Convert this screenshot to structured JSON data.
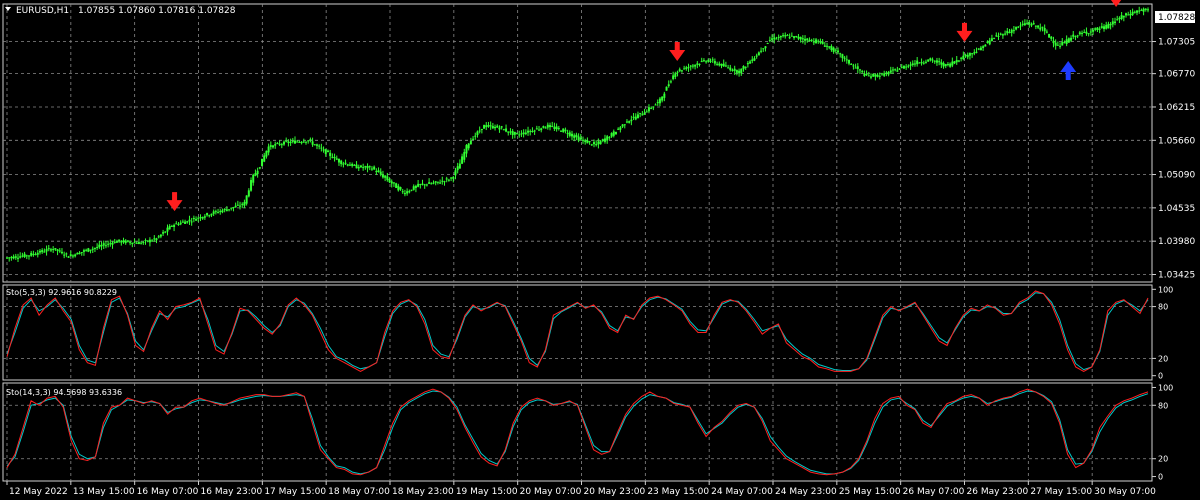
{
  "colors": {
    "background": "#000000",
    "grid": "#8a8a8a",
    "candle": "#32ff32",
    "sell_arrow": "#ff1e1e",
    "buy_arrow": "#1e3cff",
    "stoch_main": "#ff2020",
    "stoch_signal": "#00c8c8",
    "price_tag_bg": "#ffffff",
    "price_tag_text": "#000000"
  },
  "header": {
    "dropdown_icon": "triangle-down-icon",
    "symbol_info": "EURUSD,H1",
    "ohlc": "1.07855 1.07860 1.07816 1.07828"
  },
  "price_tag": "1.07828",
  "chart_data": [
    {
      "type": "candlestick",
      "name": "EURUSD,H1",
      "ylim": [
        1.033,
        1.0793
      ],
      "y_ticks": [
        "1.07828",
        "1.07305",
        "1.06770",
        "1.06215",
        "1.05660",
        "1.05090",
        "1.04535",
        "1.03980",
        "1.03425"
      ],
      "y_tick_values": [
        1.07828,
        1.07305,
        1.0677,
        1.06215,
        1.0566,
        1.0509,
        1.04535,
        1.0398,
        1.03425
      ],
      "x_tick_labels": [
        "12 May 2022",
        "13 May 15:00",
        "16 May 07:00",
        "16 May 23:00",
        "17 May 15:00",
        "18 May 07:00",
        "18 May 23:00",
        "19 May 15:00",
        "20 May 07:00",
        "20 May 23:00",
        "23 May 15:00",
        "24 May 07:00",
        "24 May 23:00",
        "25 May 15:00",
        "26 May 07:00",
        "26 May 23:00",
        "27 May 15:00",
        "30 May 07:00"
      ],
      "price_path": [
        [
          0,
          1.037
        ],
        [
          3,
          1.0375
        ],
        [
          6,
          1.0386
        ],
        [
          8,
          1.0373
        ],
        [
          10,
          1.0382
        ],
        [
          12,
          1.039
        ],
        [
          14,
          1.0398
        ],
        [
          17,
          1.0395
        ],
        [
          19,
          1.0402
        ],
        [
          21,
          1.0425
        ],
        [
          23,
          1.0432
        ],
        [
          26,
          1.0445
        ],
        [
          28,
          1.0452
        ],
        [
          30,
          1.046
        ],
        [
          31,
          1.0503
        ],
        [
          32,
          1.0525
        ],
        [
          33,
          1.0555
        ],
        [
          35,
          1.0562
        ],
        [
          38,
          1.0566
        ],
        [
          40,
          1.0548
        ],
        [
          42,
          1.053
        ],
        [
          44,
          1.0522
        ],
        [
          46,
          1.052
        ],
        [
          48,
          1.05
        ],
        [
          50,
          1.0478
        ],
        [
          52,
          1.0492
        ],
        [
          54,
          1.0495
        ],
        [
          56,
          1.0503
        ],
        [
          57,
          1.0526
        ],
        [
          58,
          1.056
        ],
        [
          59,
          1.0575
        ],
        [
          60,
          1.059
        ],
        [
          62,
          1.0587
        ],
        [
          64,
          1.0575
        ],
        [
          66,
          1.0582
        ],
        [
          68,
          1.059
        ],
        [
          70,
          1.0582
        ],
        [
          72,
          1.0568
        ],
        [
          74,
          1.0558
        ],
        [
          76,
          1.0575
        ],
        [
          78,
          1.0598
        ],
        [
          80,
          1.0612
        ],
        [
          82,
          1.063
        ],
        [
          84,
          1.068
        ],
        [
          86,
          1.069
        ],
        [
          88,
          1.07
        ],
        [
          90,
          1.069
        ],
        [
          92,
          1.068
        ],
        [
          94,
          1.0705
        ],
        [
          95,
          1.072
        ],
        [
          96,
          1.0735
        ],
        [
          98,
          1.074
        ],
        [
          100,
          1.0735
        ],
        [
          102,
          1.073
        ],
        [
          104,
          1.0715
        ],
        [
          106,
          1.0693
        ],
        [
          108,
          1.0673
        ],
        [
          110,
          1.0675
        ],
        [
          112,
          1.0685
        ],
        [
          114,
          1.0695
        ],
        [
          116,
          1.07
        ],
        [
          118,
          1.069
        ],
        [
          120,
          1.0705
        ],
        [
          122,
          1.0716
        ],
        [
          124,
          1.0738
        ],
        [
          126,
          1.0748
        ],
        [
          128,
          1.0762
        ],
        [
          130,
          1.0752
        ],
        [
          132,
          1.0722
        ],
        [
          134,
          1.074
        ],
        [
          136,
          1.0748
        ],
        [
          138,
          1.0755
        ],
        [
          140,
          1.0772
        ],
        [
          142,
          1.0782
        ],
        [
          143,
          1.0783
        ]
      ],
      "x_max": 143,
      "markers": [
        {
          "type": "sell",
          "at": 21,
          "price": 1.0463
        },
        {
          "type": "sell",
          "at": 84,
          "price": 1.0713
        },
        {
          "type": "sell",
          "at": 120,
          "price": 1.0745
        },
        {
          "type": "buy",
          "at": 133,
          "price": 1.0683
        },
        {
          "type": "sell",
          "at": 139,
          "price": 1.0803
        }
      ]
    },
    {
      "type": "line",
      "name": "Sto(5,3,3)",
      "label": "Sto(5,3,3) 92.9616 90.8229",
      "ylim": [
        -5,
        105
      ],
      "y_ticks": [
        "100",
        "80",
        "20",
        "0"
      ],
      "y_tick_values": [
        100,
        80,
        20,
        0
      ],
      "x_max": 143,
      "series": [
        {
          "name": "main",
          "values": [
            22,
            55,
            82,
            90,
            70,
            82,
            90,
            75,
            62,
            30,
            15,
            12,
            55,
            88,
            92,
            70,
            35,
            28,
            55,
            75,
            65,
            80,
            82,
            85,
            90,
            60,
            30,
            25,
            50,
            78,
            75,
            65,
            55,
            48,
            60,
            82,
            90,
            82,
            70,
            50,
            30,
            20,
            15,
            10,
            5,
            10,
            15,
            50,
            75,
            85,
            88,
            80,
            60,
            30,
            22,
            20,
            45,
            70,
            82,
            75,
            80,
            85,
            80,
            60,
            40,
            15,
            10,
            30,
            70,
            75,
            80,
            85,
            78,
            82,
            72,
            55,
            50,
            70,
            65,
            82,
            90,
            92,
            88,
            82,
            75,
            60,
            50,
            50,
            70,
            85,
            88,
            85,
            75,
            62,
            48,
            55,
            60,
            38,
            30,
            22,
            18,
            10,
            8,
            5,
            5,
            5,
            8,
            20,
            45,
            70,
            80,
            75,
            80,
            85,
            70,
            55,
            40,
            35,
            55,
            70,
            78,
            75,
            82,
            78,
            70,
            72,
            85,
            90,
            98,
            95,
            82,
            60,
            30,
            10,
            5,
            10,
            30,
            75,
            85,
            88,
            80,
            72,
            90
          ]
        },
        {
          "name": "signal",
          "values": [
            25,
            50,
            78,
            88,
            75,
            80,
            88,
            78,
            65,
            35,
            18,
            15,
            50,
            85,
            90,
            72,
            40,
            30,
            52,
            72,
            68,
            78,
            80,
            84,
            88,
            65,
            35,
            28,
            48,
            75,
            76,
            68,
            58,
            50,
            58,
            80,
            88,
            84,
            72,
            55,
            35,
            22,
            18,
            12,
            8,
            10,
            15,
            45,
            72,
            83,
            87,
            82,
            65,
            35,
            25,
            22,
            42,
            68,
            80,
            77,
            79,
            84,
            81,
            63,
            43,
            20,
            12,
            28,
            66,
            74,
            79,
            84,
            79,
            81,
            74,
            58,
            52,
            68,
            66,
            80,
            88,
            91,
            89,
            83,
            77,
            63,
            53,
            52,
            67,
            83,
            87,
            86,
            77,
            65,
            52,
            55,
            58,
            42,
            33,
            25,
            20,
            13,
            10,
            7,
            6,
            6,
            8,
            18,
            42,
            67,
            78,
            76,
            79,
            84,
            72,
            58,
            44,
            38,
            53,
            68,
            76,
            75,
            80,
            79,
            72,
            72,
            83,
            88,
            96,
            95,
            85,
            65,
            35,
            14,
            7,
            10,
            28,
            70,
            83,
            87,
            82,
            75,
            88
          ]
        }
      ]
    },
    {
      "type": "line",
      "name": "Sto(14,3,3)",
      "label": "Sto(14,3,3) 94.5698 93.6336",
      "ylim": [
        -5,
        105
      ],
      "y_ticks": [
        "100",
        "80",
        "20",
        "0"
      ],
      "y_tick_values": [
        100,
        80,
        20,
        0
      ],
      "x_max": 143,
      "series": [
        {
          "name": "main",
          "values": [
            10,
            25,
            55,
            85,
            80,
            88,
            90,
            78,
            40,
            20,
            18,
            22,
            60,
            78,
            80,
            88,
            85,
            82,
            85,
            82,
            70,
            78,
            78,
            85,
            88,
            85,
            82,
            80,
            84,
            88,
            90,
            92,
            92,
            90,
            90,
            92,
            94,
            90,
            60,
            30,
            20,
            10,
            8,
            3,
            2,
            5,
            10,
            35,
            60,
            78,
            85,
            90,
            95,
            98,
            95,
            88,
            75,
            55,
            38,
            22,
            15,
            12,
            30,
            60,
            78,
            85,
            88,
            85,
            80,
            82,
            85,
            80,
            55,
            30,
            25,
            28,
            50,
            70,
            82,
            90,
            95,
            90,
            88,
            82,
            80,
            78,
            60,
            45,
            55,
            62,
            72,
            80,
            82,
            78,
            62,
            40,
            30,
            20,
            15,
            10,
            5,
            3,
            2,
            3,
            5,
            10,
            20,
            40,
            65,
            82,
            88,
            90,
            80,
            75,
            60,
            55,
            70,
            82,
            85,
            90,
            92,
            88,
            80,
            85,
            88,
            90,
            95,
            98,
            95,
            90,
            82,
            60,
            25,
            10,
            15,
            30,
            55,
            68,
            80,
            85,
            88,
            92,
            95
          ]
        },
        {
          "name": "signal",
          "values": [
            12,
            22,
            50,
            80,
            82,
            86,
            88,
            80,
            45,
            25,
            20,
            22,
            55,
            75,
            80,
            86,
            85,
            83,
            84,
            82,
            72,
            76,
            78,
            83,
            86,
            85,
            83,
            81,
            83,
            86,
            88,
            90,
            91,
            90,
            90,
            91,
            92,
            90,
            65,
            35,
            22,
            12,
            10,
            5,
            3,
            5,
            10,
            30,
            55,
            75,
            83,
            88,
            93,
            96,
            95,
            89,
            78,
            58,
            42,
            26,
            18,
            14,
            28,
            56,
            75,
            83,
            86,
            85,
            81,
            82,
            84,
            81,
            58,
            35,
            28,
            28,
            47,
            67,
            79,
            87,
            92,
            90,
            88,
            83,
            81,
            78,
            63,
            48,
            54,
            60,
            70,
            78,
            81,
            78,
            65,
            45,
            33,
            23,
            17,
            12,
            7,
            5,
            3,
            3,
            5,
            9,
            18,
            37,
            60,
            78,
            86,
            88,
            82,
            76,
            63,
            57,
            68,
            79,
            84,
            88,
            90,
            88,
            82,
            84,
            87,
            89,
            93,
            96,
            95,
            91,
            84,
            64,
            30,
            14,
            15,
            28,
            50,
            65,
            77,
            83,
            86,
            90,
            93
          ]
        }
      ]
    }
  ]
}
